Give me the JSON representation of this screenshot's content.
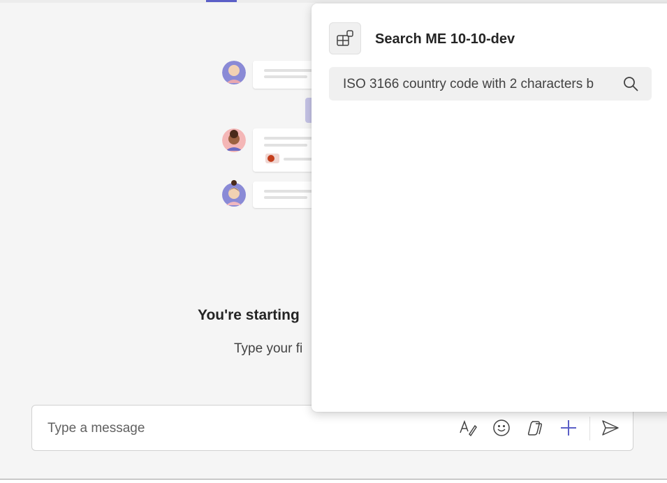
{
  "chat": {
    "empty_title": "You're starting",
    "empty_subtitle": "Type your fi"
  },
  "composer": {
    "placeholder": "Type a message",
    "tools": [
      "format-icon",
      "emoji-icon",
      "copilot-icon",
      "add-icon",
      "send-icon"
    ]
  },
  "popup": {
    "title": "Search ME 10-10-dev",
    "search_value": "ISO 3166 country code with 2 characters b",
    "app_icon": "app-grid-icon"
  },
  "colors": {
    "accent": "#5b5fc7",
    "background": "#f5f5f5"
  }
}
